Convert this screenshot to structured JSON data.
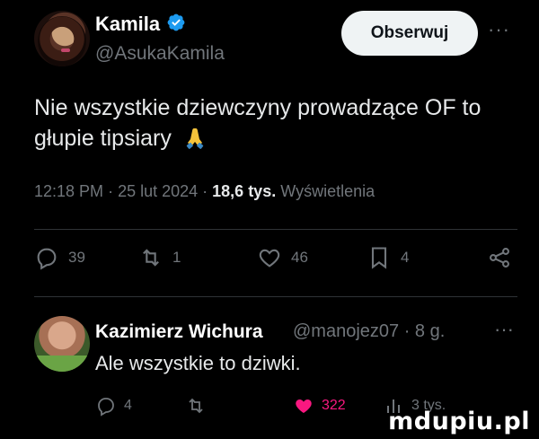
{
  "tweet": {
    "author_name": "Kamila",
    "author_handle": "@AsukaKamila",
    "follow_label": "Obserwuj",
    "more_label": "···",
    "text": "Nie wszystkie dziewczyny prowadzące OF to głupie tipsiary",
    "emoji": "🙏",
    "time": "12:18 PM",
    "date": "25 lut 2024",
    "views_count": "18,6 tys.",
    "views_label": "Wyświetlenia",
    "actions": {
      "replies": "39",
      "retweets": "1",
      "likes": "46",
      "bookmarks": "4"
    },
    "icons": {
      "verified": "verified-badge-icon",
      "reply": "reply-icon",
      "retweet": "retweet-icon",
      "like": "heart-icon",
      "bookmark": "bookmark-icon",
      "share": "share-icon"
    },
    "colors": {
      "verified": "#1d9bf0",
      "follow_bg": "#eff3f4",
      "muted": "#71767b"
    }
  },
  "reply": {
    "author_name": "Kazimierz Wichura",
    "author_handle": "@manojez07 · 8 g.",
    "more_label": "···",
    "text": "Ale wszystkie to dziwki.",
    "actions": {
      "replies": "4",
      "retweets": "",
      "likes": "322",
      "views": "3 tys."
    },
    "colors": {
      "like": "#f91880"
    }
  },
  "watermark": "mdupiu.pl"
}
